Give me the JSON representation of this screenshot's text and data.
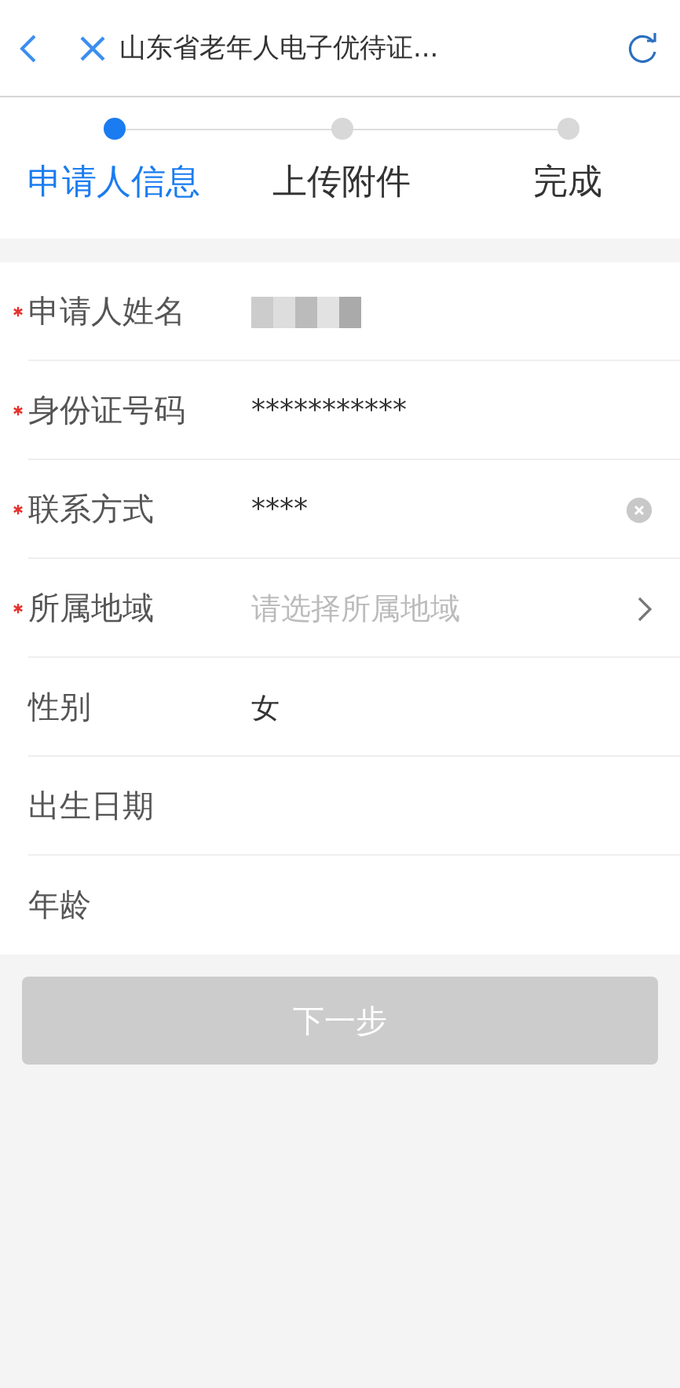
{
  "header": {
    "title": "山东省老年人电子优待证..."
  },
  "steps": [
    {
      "label": "申请人信息",
      "selected": true
    },
    {
      "label": "上传附件",
      "selected": false
    },
    {
      "label": "完成",
      "selected": false
    }
  ],
  "fields": [
    {
      "kind": "redacted",
      "label": "申请人姓名",
      "required": true
    },
    {
      "kind": "text",
      "label": "身份证号码",
      "required": true,
      "value": "***********"
    },
    {
      "kind": "clearable",
      "label": "联系方式",
      "required": true,
      "value": "****"
    },
    {
      "kind": "select",
      "label": "所属地域",
      "required": true,
      "placeholder": "请选择所属地域"
    },
    {
      "kind": "text",
      "label": "性别",
      "required": false,
      "value": "女"
    },
    {
      "kind": "empty",
      "label": "出生日期",
      "required": false
    },
    {
      "kind": "empty",
      "label": "年龄",
      "required": false
    }
  ],
  "next_button": {
    "label": "下一步",
    "disabled": true
  }
}
